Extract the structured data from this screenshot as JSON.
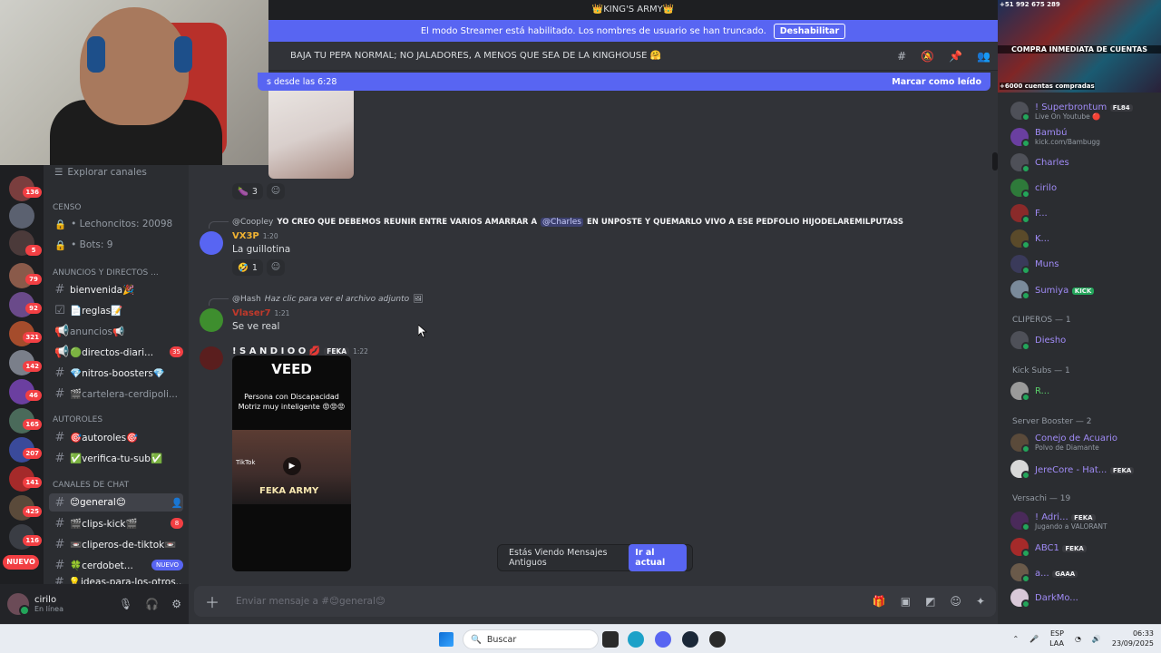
{
  "window": {
    "server_name": "👑KING'S ARMY👑"
  },
  "streamer_banner": {
    "text": "El modo Streamer está habilitado. Los nombres de usuario se han truncado.",
    "button": "Deshabilitar"
  },
  "channel_header": {
    "topic": "BAJA TU PEPA NORMAL; NO JALADORES, A MENOS QUE SEA DE LA KINGHOUSE 🤗"
  },
  "new_messages_bar": {
    "text": "s desde las 6:28",
    "mark_read": "Marcar como leído"
  },
  "sidebar": {
    "explore": "Explorar canales",
    "census_category": "CENSO",
    "lechoncitos": "• Lechoncitos: 20098",
    "bots": "• Bots: 9",
    "announcements_category": "ANUNCIOS Y DIRECTOS ...",
    "autoroles_category": "AUTOROLES",
    "chat_category": "CANALES DE CHAT",
    "channels": [
      {
        "name": "bienvenida🎉",
        "count": ""
      },
      {
        "name": "📄reglas📝",
        "count": ""
      },
      {
        "name": "anuncios📢",
        "count": ""
      },
      {
        "name": "🟢directos-diari...",
        "count": "35"
      },
      {
        "name": "💎nitros-boosters💎",
        "count": ""
      },
      {
        "name": "🎬cartelera-cerdipoli...",
        "count": ""
      },
      {
        "name": "🎯autoroles🎯",
        "count": ""
      },
      {
        "name": "✅verifica-tu-sub✅",
        "count": ""
      },
      {
        "name": "😊general😊",
        "count": ""
      },
      {
        "name": "🎬clips-kick🎬",
        "count": "8"
      },
      {
        "name": "📼cliperos-de-tiktok📼",
        "count": ""
      },
      {
        "name": "🍀cerdobet...",
        "new": "NUEVO"
      },
      {
        "name": "💡ideas-para-los-otros...",
        "count": ""
      }
    ]
  },
  "server_rail": {
    "badges": [
      "136",
      "5",
      "79",
      "92",
      "321",
      "142",
      "46",
      "165",
      "207",
      "141",
      "425",
      "116"
    ],
    "new_label": "NUEVO"
  },
  "user_panel": {
    "name": "cirilo",
    "status": "En línea"
  },
  "messages": {
    "reaction1": {
      "emoji": "🍆",
      "count": "3"
    },
    "msg1": {
      "reply_user": "@Coopley",
      "reply_text_a": "YO CREO QUE DEBEMOS REUNIR ENTRE VARIOS AMARRAR A",
      "reply_mention": "@Charles",
      "reply_text_b": "EN UNPOSTE Y QUEMARLO VIVO A ESE PEDFOLIO HIJODELAREMILPUTASS",
      "author": "VX3P",
      "time": "1:20",
      "text": "La guillotina",
      "reaction": {
        "emoji": "🤣",
        "count": "1"
      }
    },
    "msg2": {
      "reply_user": "@Hash",
      "reply_text": "Haz clic para ver el archivo adjunto",
      "author": "Vlaser7",
      "time": "1:21",
      "text": "Se ve real"
    },
    "msg3": {
      "author": "! S A N D I O O 💋",
      "tag": "FEKA",
      "time": "1:22",
      "video_brand": "VEED",
      "video_caption": "Persona con Discapacidad Motriz muy inteligente 😡😡😡",
      "video_overlay": "FEKA ARMY",
      "tiktok": "TikTok"
    }
  },
  "old_messages": {
    "text": "Estás Viendo Mensajes Antiguos",
    "button": "Ir al actual"
  },
  "composer": {
    "placeholder": "Enviar mensaje a #😊general😊"
  },
  "members": {
    "banner_top": "+51 992 675 289",
    "banner_mid": "COMPRA INMEDIATA DE CUENTAS",
    "banner_bottom": "+6000 cuentas compradas",
    "list1": [
      {
        "name": "! Superbrontum",
        "tag": "FL84",
        "sub": "Live On Youtube 🔴"
      },
      {
        "name": "Bambú",
        "sub": "kick.com/Bambugg"
      },
      {
        "name": "Charles"
      },
      {
        "name": "cirilo"
      },
      {
        "name": "F..."
      },
      {
        "name": "K..."
      },
      {
        "name": "Muns"
      },
      {
        "name": "Sumiya",
        "tag": "KICK"
      }
    ],
    "clip_cat": "CLIPEROS — 1",
    "clip_members": [
      {
        "name": "Diesho"
      }
    ],
    "kick_cat": "Kick Subs — 1",
    "kick_members": [
      {
        "name": "R..."
      }
    ],
    "booster_cat": "Server Booster — 2",
    "booster_members": [
      {
        "name": "Conejo de Acuario",
        "sub": "Polvo de Diamante"
      },
      {
        "name": "JereCore - Hat...",
        "tag": "FEKA"
      }
    ],
    "versachi_cat": "Versachi — 19",
    "versachi_members": [
      {
        "name": "! Adri...",
        "tag": "FEKA",
        "sub": "Jugando a VALORANT"
      },
      {
        "name": "ABC1",
        "tag": "FEKA"
      },
      {
        "name": "a...",
        "tag": "GAAA"
      },
      {
        "name": "DarkMo..."
      }
    ]
  },
  "taskbar": {
    "search": "Buscar",
    "lang1": "ESP",
    "lang2": "LAA",
    "time": "06:33",
    "date": "23/09/2025"
  }
}
